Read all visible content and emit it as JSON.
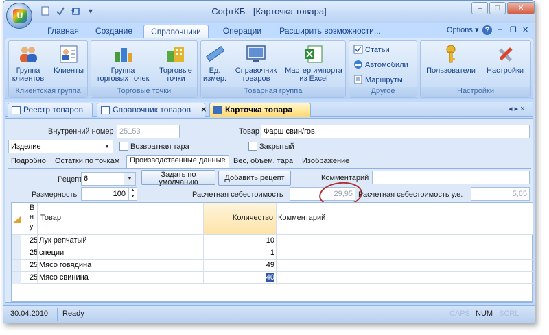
{
  "window": {
    "title": "СофтКБ - [Карточка товара]",
    "buttons": {
      "minimize": "–",
      "maximize": "□",
      "close": "✕"
    }
  },
  "qat": {
    "new_icon": "page-icon",
    "check_icon": "checkmark-icon",
    "back_icon": "undo-icon",
    "more": "▾"
  },
  "ribbon": {
    "tabs": [
      "Главная",
      "Создание",
      "Справочники",
      "Операции",
      "Расширить возможности..."
    ],
    "active_tab": "Справочники",
    "options_label": "Options",
    "help": "?",
    "groups": {
      "clients": {
        "label": "Клиентская группа",
        "buttons": [
          {
            "label_1": "Группа",
            "label_2": "клиентов",
            "icon": "people-icon"
          },
          {
            "label_1": "Клиенты",
            "label_2": "",
            "icon": "contact-card-icon"
          }
        ]
      },
      "points": {
        "label": "Торговые точки",
        "buttons": [
          {
            "label_1": "Группа",
            "label_2": "торговых точек",
            "icon": "building-group-icon"
          },
          {
            "label_1": "Торговые",
            "label_2": "точки",
            "icon": "buildings-icon"
          }
        ]
      },
      "goods": {
        "label": "Товарная группа",
        "buttons": [
          {
            "label_1": "Ед.",
            "label_2": "измер.",
            "icon": "ruler-icon"
          },
          {
            "label_1": "Справочник",
            "label_2": "товаров",
            "icon": "monitor-icon"
          },
          {
            "label_1": "Мастер импорта",
            "label_2": "из Excel",
            "icon": "excel-icon"
          }
        ]
      },
      "other": {
        "label": "Другое",
        "buttons": [
          {
            "label": "Статьи",
            "icon": "checklist-icon"
          },
          {
            "label": "Автомобили",
            "icon": "car-icon"
          },
          {
            "label": "Маршруты",
            "icon": "route-icon"
          }
        ]
      },
      "settings": {
        "label": "Настройки",
        "buttons": [
          {
            "label": "Пользователи",
            "icon": "key-icon"
          },
          {
            "label": "Настройки",
            "icon": "tools-icon"
          }
        ]
      }
    }
  },
  "doc_tabs": [
    {
      "label": "Реестр товаров",
      "active": false
    },
    {
      "label": "Справочник товаров",
      "active": false
    },
    {
      "label": "Карточка товара",
      "active": true
    }
  ],
  "doc_tab_controls": {
    "close": "×",
    "nav": "◂ ▸ ×"
  },
  "form": {
    "internal_number_label": "Внутренний номер",
    "internal_number_value": "25153",
    "product_label": "Товар",
    "product_value": "Фарш свин/гов.",
    "type_value": "Изделие",
    "returnable_label": "Возвратная тара",
    "closed_label": "Закрытый",
    "tabs": [
      "Подробно",
      "Остатки по точкам",
      "Производственные данные",
      "Вес, объем, тара",
      "Изображение"
    ],
    "active_tab": "Производственные данные",
    "recipe_label": "Рецепт",
    "recipe_value": "6",
    "set_default_label_1": "Задать по",
    "set_default_label_2": "умолчанию",
    "add_recipe_label": "Добавить рецепт",
    "comment_label": "Комментарий",
    "comment_value": "",
    "size_label": "Размерность",
    "size_value": "100",
    "calc_cost_label": "Расчетная себестоимость",
    "calc_cost_value": "29,95",
    "calc_cost_ue_label": "Расчетная себестоимость у.е.",
    "calc_cost_ue_value": "5,65"
  },
  "grid": {
    "columns": {
      "id_1": "В",
      "id_2": "н",
      "id_3": "у",
      "product": "Товар",
      "quantity": "Количество",
      "comment": "Комментарий"
    },
    "rows": [
      {
        "id": "25",
        "product": "Лук репчатый",
        "quantity": "10",
        "comment": ""
      },
      {
        "id": "25",
        "product": "специи",
        "quantity": "1",
        "comment": ""
      },
      {
        "id": "25",
        "product": "Мясо говядина",
        "quantity": "49",
        "comment": ""
      },
      {
        "id": "25",
        "product": "Мясо свинина",
        "quantity": "40",
        "comment": ""
      }
    ]
  },
  "status": {
    "date": "30.04.2010",
    "state": "Ready",
    "caps": "CAPS",
    "num": "NUM",
    "scrl": "SCRL"
  }
}
